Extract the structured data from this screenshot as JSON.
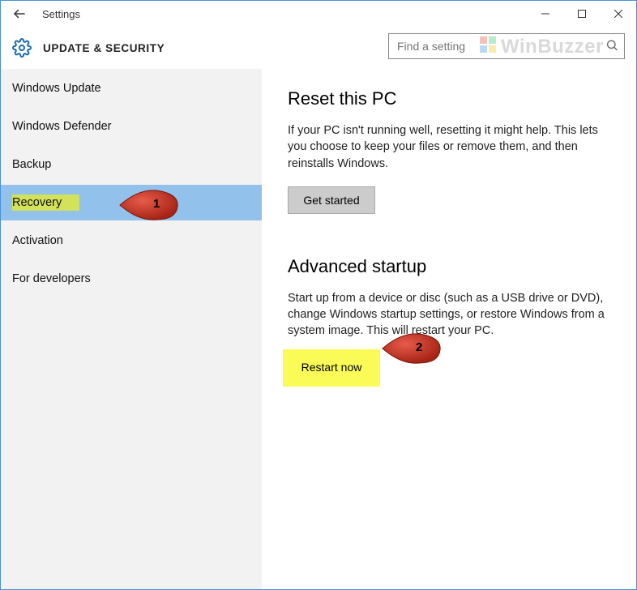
{
  "window": {
    "title": "Settings"
  },
  "header": {
    "page_title": "UPDATE & SECURITY",
    "search_placeholder": "Find a setting"
  },
  "sidebar": {
    "items": [
      {
        "label": "Windows Update"
      },
      {
        "label": "Windows Defender"
      },
      {
        "label": "Backup"
      },
      {
        "label": "Recovery"
      },
      {
        "label": "Activation"
      },
      {
        "label": "For developers"
      }
    ],
    "selected_index": 3
  },
  "content": {
    "sections": [
      {
        "heading": "Reset this PC",
        "body": "If your PC isn't running well, resetting it might help. This lets you choose to keep your files or remove them, and then reinstalls Windows.",
        "button": "Get started"
      },
      {
        "heading": "Advanced startup",
        "body": "Start up from a device or disc (such as a USB drive or DVD), change Windows startup settings, or restore Windows from a system image. This will restart your PC.",
        "button": "Restart now"
      }
    ]
  },
  "callouts": {
    "one": "1",
    "two": "2"
  },
  "watermark": "WinBuzzer"
}
